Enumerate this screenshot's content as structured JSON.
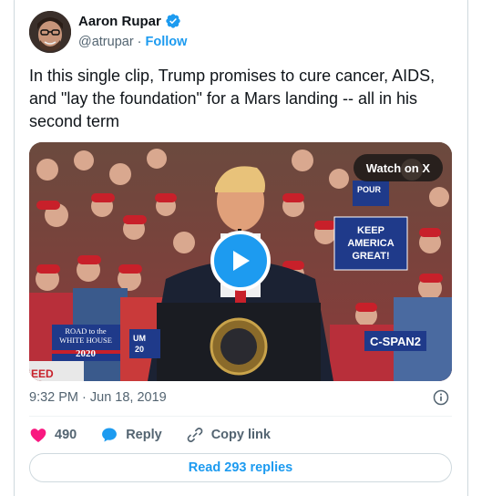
{
  "author": {
    "name": "Aaron Rupar",
    "handle": "@atrupar",
    "separator": "·",
    "follow_label": "Follow"
  },
  "tweet": {
    "text": "In this single clip, Trump promises to cure cancer, AIDS, and \"lay the foundation\" for a Mars landing -- all in his second term",
    "timestamp": "9:32 PM · Jun 18, 2019"
  },
  "video": {
    "watch_label": "Watch on X",
    "signs": {
      "keep_america_great": [
        "KEEP",
        "AMERICA",
        "GREAT!"
      ],
      "road_to_wh": [
        "ROAD to the",
        "WHITE HOUSE",
        "2020"
      ],
      "cspan": "C-SPAN2",
      "partial_1": "POUR",
      "partial_2": "UM",
      "partial_3": "20",
      "partial_4": "EED"
    }
  },
  "actions": {
    "likes": "490",
    "reply_label": "Reply",
    "copy_label": "Copy link"
  },
  "read_replies_label": "Read 293 replies",
  "colors": {
    "accent": "#1d9bf0",
    "like": "#f91880",
    "text": "#0f1419",
    "muted": "#536471"
  }
}
